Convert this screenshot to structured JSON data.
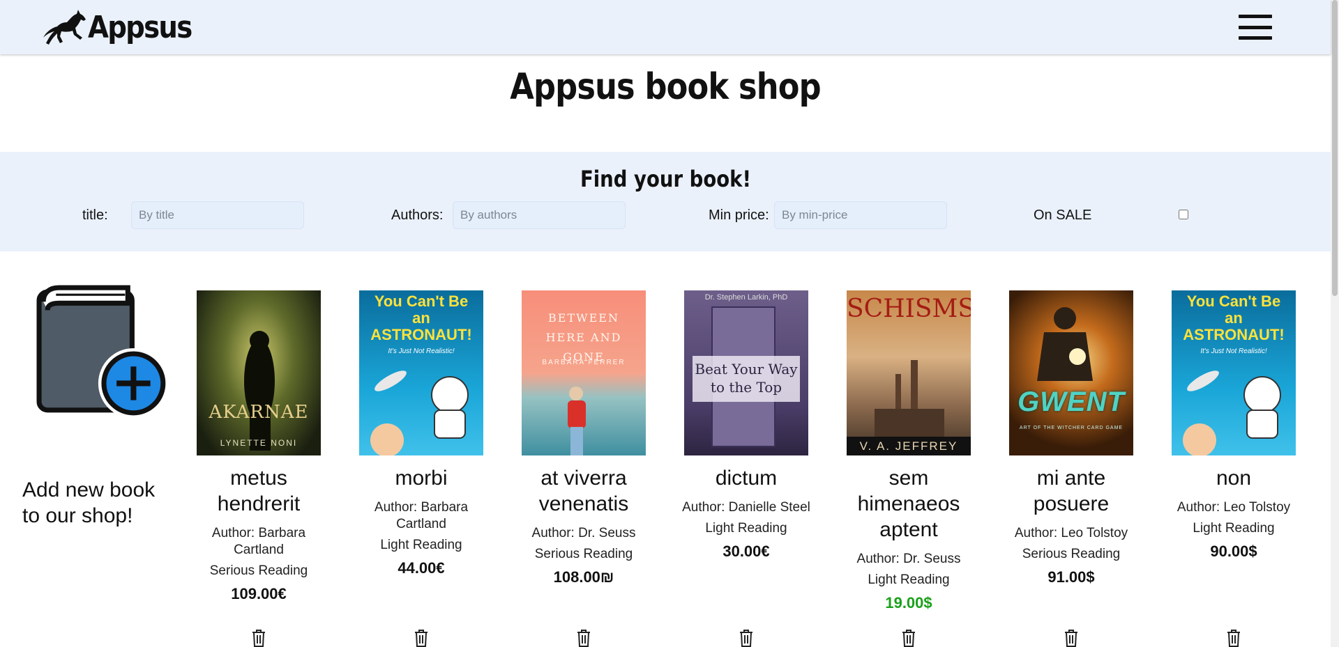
{
  "header": {
    "logo_text": "Appsus",
    "logo_icon": "horse-icon",
    "menu_icon": "hamburger-icon"
  },
  "page": {
    "title": "Appsus book shop"
  },
  "filter": {
    "heading": "Find your book!",
    "title_label": "title:",
    "title_placeholder": "By title",
    "authors_label": "Authors:",
    "authors_placeholder": "By authors",
    "price_label": "Min price:",
    "price_placeholder": "By min-price",
    "sale_label": "On SALE",
    "sale_checked": false
  },
  "add_book": {
    "text": "Add new book to our shop!",
    "icon": "add-book-icon"
  },
  "books": [
    {
      "title": "metus hendrerit",
      "author": "Author: Barbara Cartland",
      "category": "Serious Reading",
      "price": "109.00€",
      "on_sale": false,
      "cover_text": "AKARNAE",
      "cover_sub": "LYNETTE NONI"
    },
    {
      "title": "morbi",
      "author": "Author: Barbara Cartland",
      "category": "Light Reading",
      "price": "44.00€",
      "on_sale": false,
      "cover_text": "You Can't Be an ASTRONAUT!",
      "cover_sub": "It's Just Not Realistic!"
    },
    {
      "title": "at viverra venenatis",
      "author": "Author: Dr. Seuss",
      "category": "Serious Reading",
      "price": "108.00₪",
      "on_sale": false,
      "cover_text": "BETWEEN HERE AND GONE",
      "cover_sub": "BARBARA FERRER"
    },
    {
      "title": "dictum",
      "author": "Author: Danielle Steel",
      "category": "Light Reading",
      "price": "30.00€",
      "on_sale": false,
      "cover_text": "Beat Your Way to the Top",
      "cover_sub": "Dr. Stephen Larkin, PhD"
    },
    {
      "title": "sem himenaeos aptent",
      "author": "Author: Dr. Seuss",
      "category": "Light Reading",
      "price": "19.00$",
      "on_sale": true,
      "cover_text": "SCHISMS",
      "cover_sub": "V. A. JEFFREY"
    },
    {
      "title": "mi ante posuere",
      "author": "Author: Leo Tolstoy",
      "category": "Serious Reading",
      "price": "91.00$",
      "on_sale": false,
      "cover_text": "GWENT",
      "cover_sub": "ART OF THE WITCHER CARD GAME"
    },
    {
      "title": "non",
      "author": "Author: Leo Tolstoy",
      "category": "Light Reading",
      "price": "90.00$",
      "on_sale": false,
      "cover_text": "You Can't Be an ASTRONAUT!",
      "cover_sub": "It's Just Not Realistic!"
    }
  ],
  "colors": {
    "header_bg": "#eaf1fb",
    "filter_bg": "#eaf1fb",
    "sale_price": "#1aa01a",
    "add_icon_blue": "#1e88e5"
  }
}
